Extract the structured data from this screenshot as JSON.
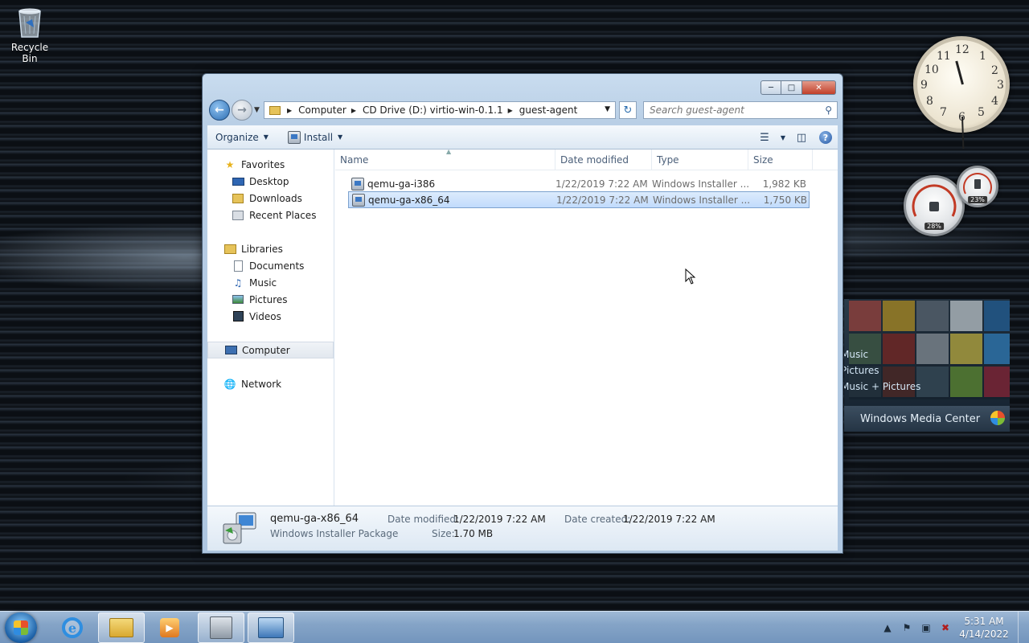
{
  "desktop": {
    "recycle_bin_label": "Recycle Bin"
  },
  "explorer": {
    "breadcrumb": [
      "Computer",
      "CD Drive (D:) virtio-win-0.1.1",
      "guest-agent"
    ],
    "search_placeholder": "Search guest-agent",
    "toolbar": {
      "organize_label": "Organize",
      "install_label": "Install"
    },
    "nav_pane": {
      "favorites_label": "Favorites",
      "desktop_label": "Desktop",
      "downloads_label": "Downloads",
      "recent_places_label": "Recent Places",
      "libraries_label": "Libraries",
      "documents_label": "Documents",
      "music_label": "Music",
      "pictures_label": "Pictures",
      "videos_label": "Videos",
      "computer_label": "Computer",
      "network_label": "Network"
    },
    "columns": {
      "name": "Name",
      "date_modified": "Date modified",
      "type": "Type",
      "size": "Size"
    },
    "files": [
      {
        "name": "qemu-ga-i386",
        "date": "1/22/2019 7:22 AM",
        "type": "Windows Installer ...",
        "size": "1,982 KB"
      },
      {
        "name": "qemu-ga-x86_64",
        "date": "1/22/2019 7:22 AM",
        "type": "Windows Installer ...",
        "size": "1,750 KB"
      }
    ],
    "details": {
      "name": "qemu-ga-x86_64",
      "type": "Windows Installer Package",
      "date_modified_label": "Date modified:",
      "date_modified": "1/22/2019 7:22 AM",
      "size_label": "Size:",
      "size": "1.70 MB",
      "date_created_label": "Date created:",
      "date_created": "1/22/2019 7:22 AM"
    }
  },
  "gadgets": {
    "clock_numbers": [
      "12",
      "1",
      "2",
      "3",
      "4",
      "5",
      "6",
      "7",
      "8",
      "9",
      "10",
      "11"
    ],
    "cpu_percent": "28%",
    "memory_percent": "23%",
    "media_center": {
      "menu_items": [
        "Music",
        "Pictures",
        "Music + Pictures"
      ],
      "title": "Windows Media Center"
    }
  },
  "taskbar": {
    "time": "5:31 AM",
    "date": "4/14/2022"
  }
}
